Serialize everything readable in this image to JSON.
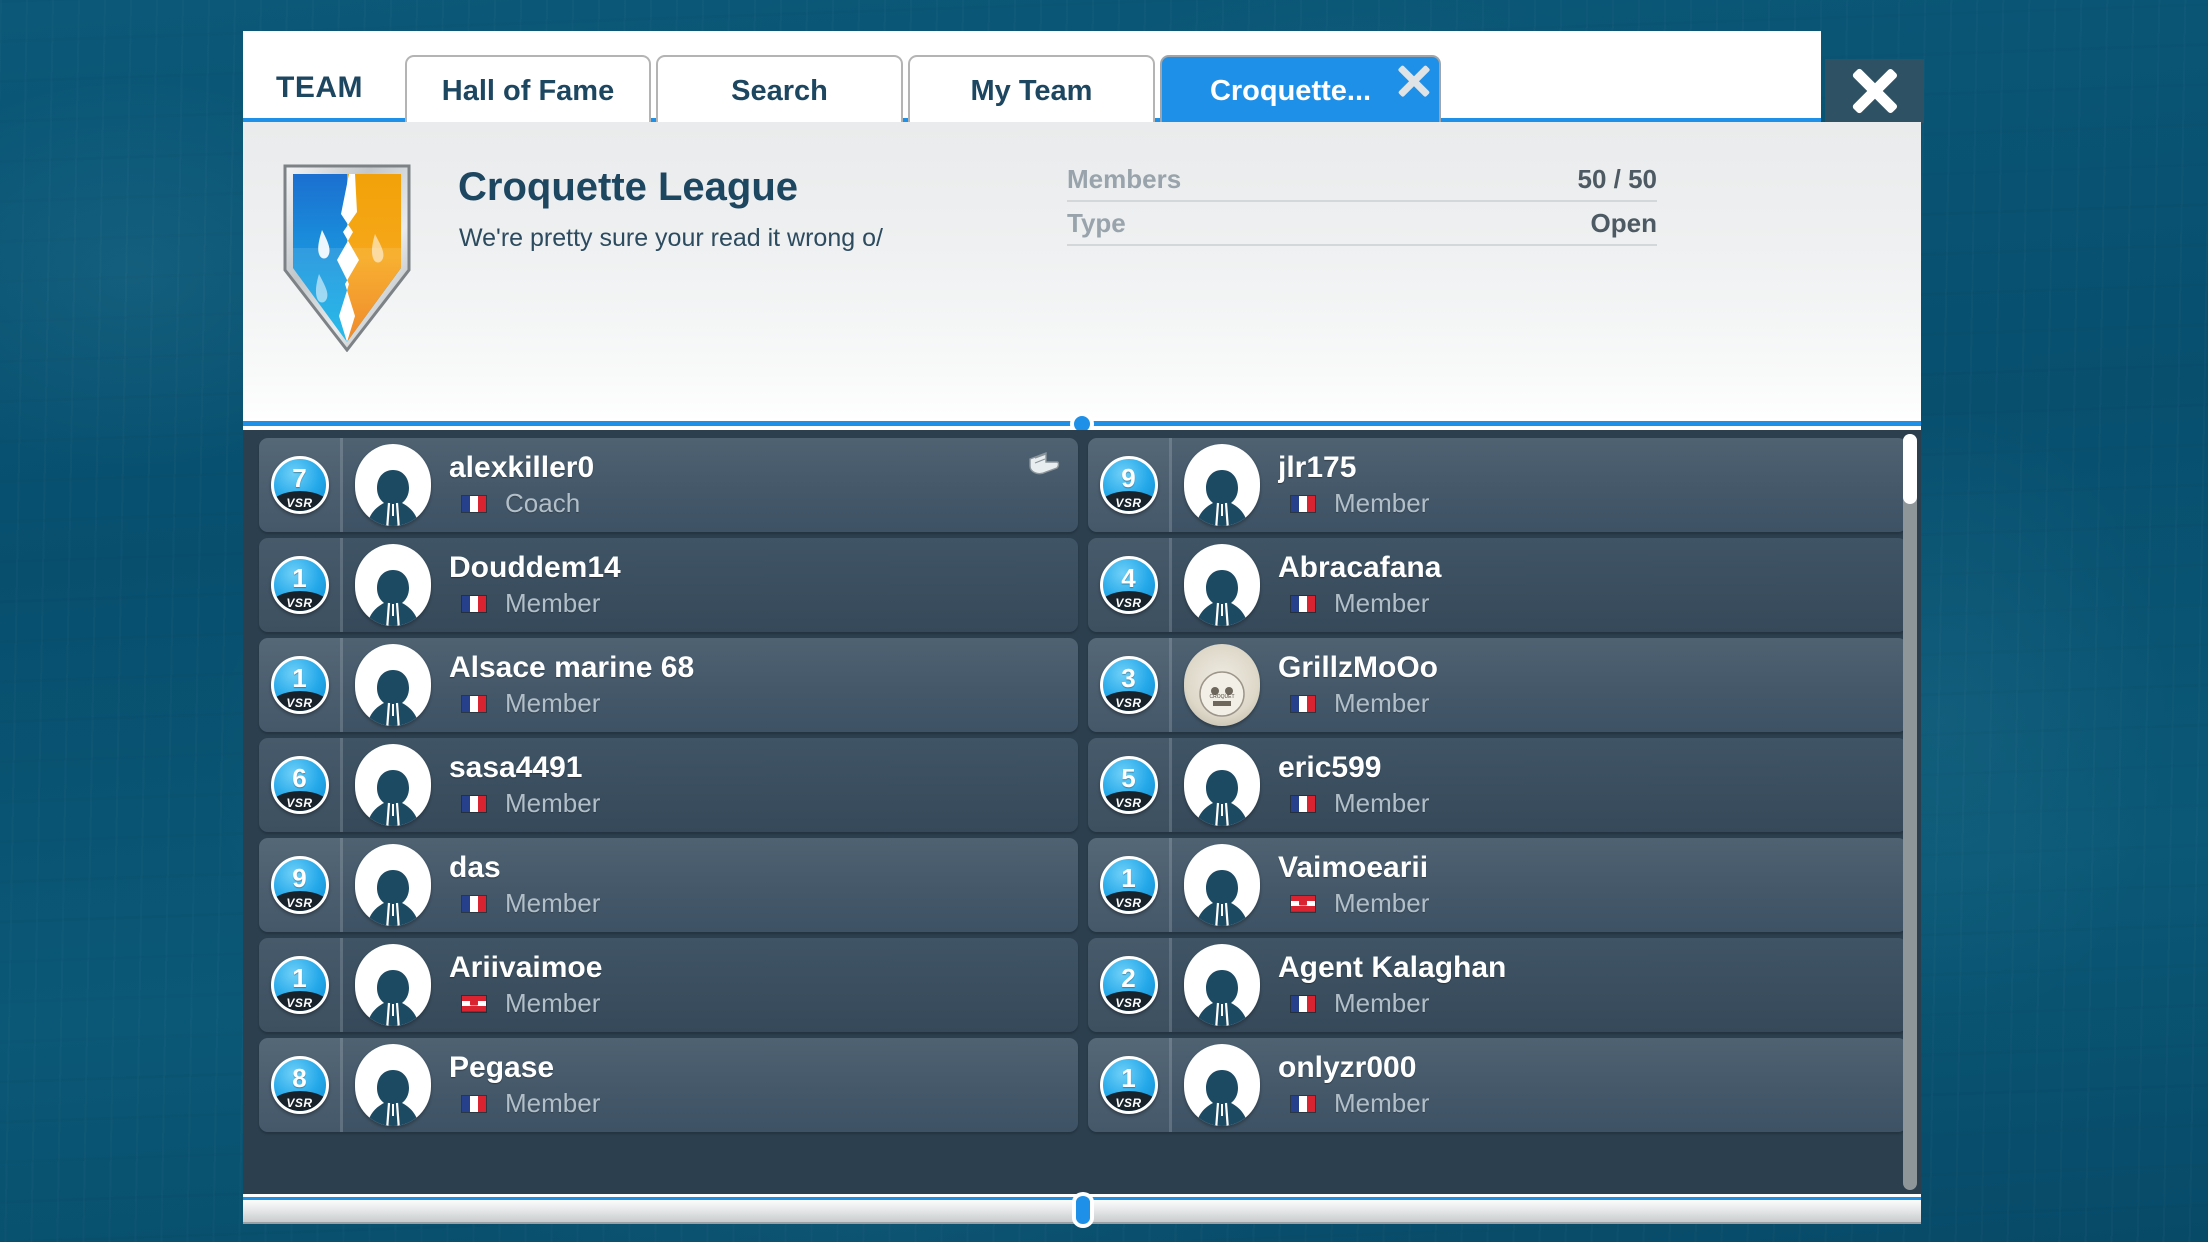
{
  "window": {
    "team_label": "TEAM",
    "close_label": "✕"
  },
  "tabs": [
    {
      "id": "hall-of-fame",
      "label": "Hall of Fame",
      "active": false
    },
    {
      "id": "search",
      "label": "Search",
      "active": false
    },
    {
      "id": "my-team",
      "label": "My Team",
      "active": false
    },
    {
      "id": "croquette",
      "label": "Croquette...",
      "active": true
    }
  ],
  "team": {
    "name": "Croquette League",
    "motto": "We're pretty sure your read it wrong o/",
    "emblem": "shield-emblem",
    "info": [
      {
        "key": "Members",
        "value": "50 / 50"
      },
      {
        "key": "Type",
        "value": "Open"
      }
    ]
  },
  "members": [
    {
      "rank": "7",
      "rank_suffix": "VSR",
      "name": "alexkiller0",
      "flag": "fr",
      "role": "Coach",
      "avatar": "default",
      "coach": true
    },
    {
      "rank": "9",
      "rank_suffix": "VSR",
      "name": "jlr175",
      "flag": "fr",
      "role": "Member",
      "avatar": "default",
      "coach": false
    },
    {
      "rank": "1",
      "rank_suffix": "VSR",
      "name": "Douddem14",
      "flag": "fr",
      "role": "Member",
      "avatar": "default",
      "coach": false
    },
    {
      "rank": "4",
      "rank_suffix": "VSR",
      "name": "Abracafana",
      "flag": "fr",
      "role": "Member",
      "avatar": "default",
      "coach": false
    },
    {
      "rank": "1",
      "rank_suffix": "VSR",
      "name": "Alsace marine 68",
      "flag": "fr",
      "role": "Member",
      "avatar": "default",
      "coach": false
    },
    {
      "rank": "3",
      "rank_suffix": "VSR",
      "name": "GrillzMoOo",
      "flag": "fr",
      "role": "Member",
      "avatar": "special",
      "coach": false
    },
    {
      "rank": "6",
      "rank_suffix": "VSR",
      "name": "sasa4491",
      "flag": "fr",
      "role": "Member",
      "avatar": "default",
      "coach": false
    },
    {
      "rank": "5",
      "rank_suffix": "VSR",
      "name": "eric599",
      "flag": "fr",
      "role": "Member",
      "avatar": "default",
      "coach": false
    },
    {
      "rank": "9",
      "rank_suffix": "VSR",
      "name": "das",
      "flag": "fr",
      "role": "Member",
      "avatar": "default",
      "coach": false
    },
    {
      "rank": "1",
      "rank_suffix": "VSR",
      "name": "Vaimoearii",
      "flag": "pf",
      "role": "Member",
      "avatar": "default",
      "coach": false
    },
    {
      "rank": "1",
      "rank_suffix": "VSR",
      "name": "Ariivaimoe",
      "flag": "pf",
      "role": "Member",
      "avatar": "default",
      "coach": false
    },
    {
      "rank": "2",
      "rank_suffix": "VSR",
      "name": "Agent Kalaghan",
      "flag": "fr",
      "role": "Member",
      "avatar": "default",
      "coach": false
    },
    {
      "rank": "8",
      "rank_suffix": "VSR",
      "name": "Pegase",
      "flag": "fr",
      "role": "Member",
      "avatar": "default",
      "coach": false
    },
    {
      "rank": "1",
      "rank_suffix": "VSR",
      "name": "onlyzr000",
      "flag": "fr",
      "role": "Member",
      "avatar": "default",
      "coach": false
    }
  ],
  "colors": {
    "accent_blue": "#1e90e8",
    "panel_dark": "#2b3f4e",
    "row_light": "#4e6272",
    "row_dark": "#3f5465",
    "background": "#0a5272",
    "header_text": "#1d4661"
  }
}
